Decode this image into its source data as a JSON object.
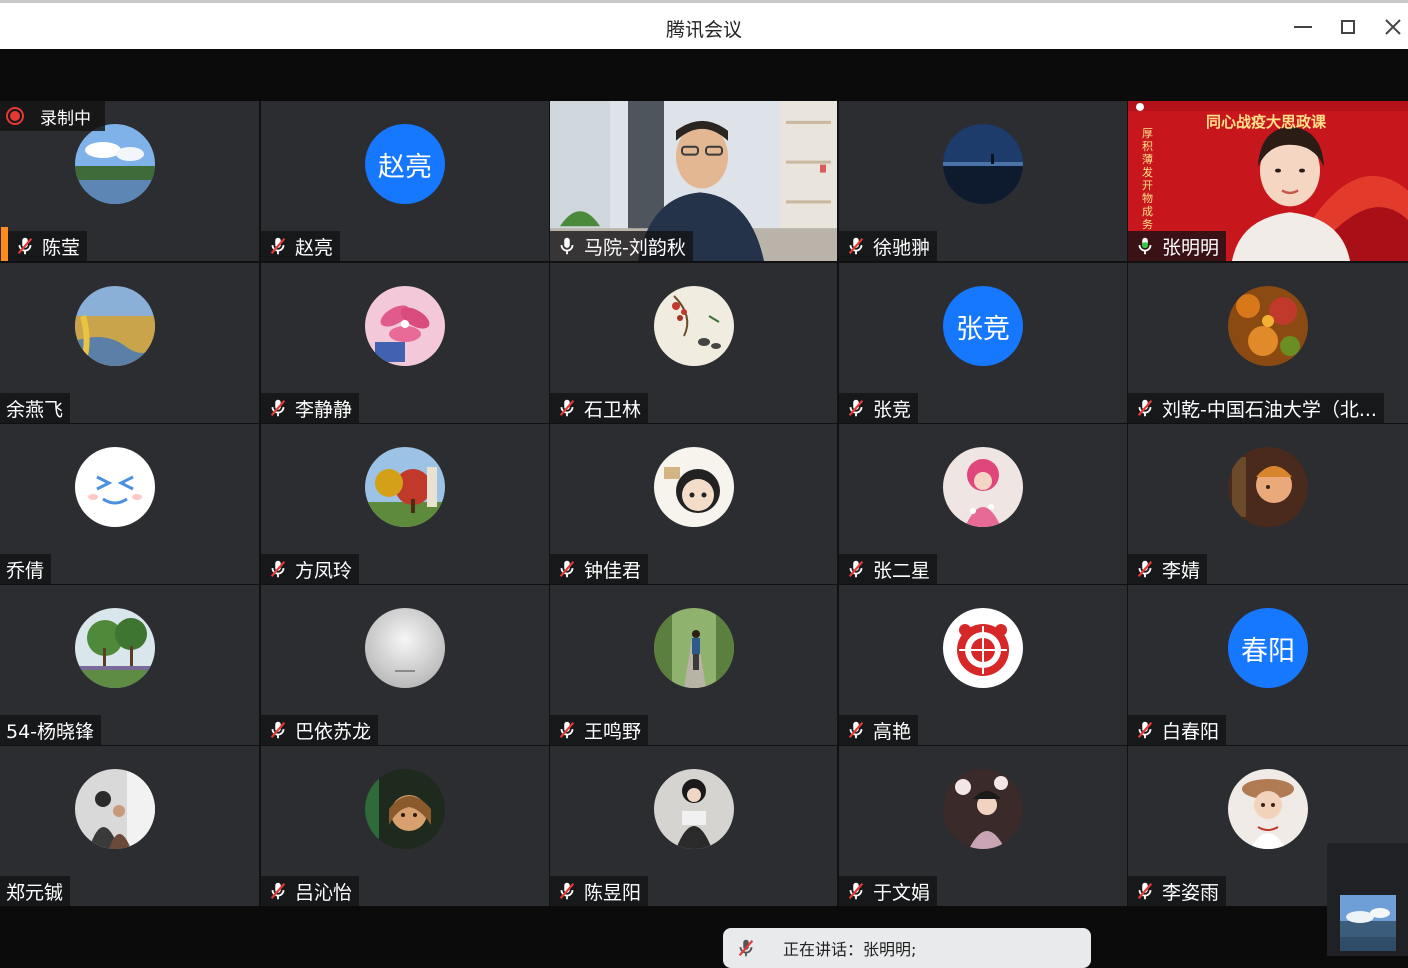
{
  "window": {
    "title": "腾讯会议"
  },
  "recording": {
    "label": "录制中"
  },
  "participants": [
    {
      "name": "陈莹",
      "avatar": "landscape-lake-photo",
      "mic": "muted"
    },
    {
      "name": "赵亮",
      "avatar_text": "赵亮",
      "mic": "muted"
    },
    {
      "name": "马院-刘韵秋",
      "video": "man-in-room-camera",
      "mic": "unmuted"
    },
    {
      "name": "徐驰翀",
      "avatar": "night-sky-photo",
      "mic": "muted"
    },
    {
      "name": "张明明",
      "video": "woman-red-banner-camera",
      "mic": "speaking"
    },
    {
      "name": "余燕飞",
      "avatar": "autumn-wetland-photo",
      "mic": "none"
    },
    {
      "name": "李静静",
      "avatar": "pink-flower-photo",
      "mic": "muted"
    },
    {
      "name": "石卫林",
      "avatar": "ink-painting-birds",
      "mic": "muted"
    },
    {
      "name": "张竞",
      "avatar_text": "张竞",
      "mic": "muted"
    },
    {
      "name": "刘乾-中国石油大学（北...",
      "avatar": "autumn-leaves-photo",
      "mic": "muted"
    },
    {
      "name": "乔倩",
      "avatar": "smiley-face",
      "mic": "none"
    },
    {
      "name": "方凤玲",
      "avatar": "red-tree-photo",
      "mic": "muted"
    },
    {
      "name": "钟佳君",
      "avatar": "cartoon-girl-drawing",
      "mic": "muted"
    },
    {
      "name": "张二星",
      "avatar": "pink-doll-photo",
      "mic": "muted"
    },
    {
      "name": "李婧",
      "avatar": "child-portrait-photo",
      "mic": "muted"
    },
    {
      "name": "54-杨晓锋",
      "avatar": "green-trees-photo",
      "mic": "none"
    },
    {
      "name": "巴依苏龙",
      "avatar": "foggy-sky-photo",
      "mic": "muted"
    },
    {
      "name": "王鸣野",
      "avatar": "person-walking-photo",
      "mic": "muted"
    },
    {
      "name": "高艳",
      "avatar": "red-papercut",
      "mic": "muted"
    },
    {
      "name": "白春阳",
      "avatar_text": "春阳",
      "mic": "muted"
    },
    {
      "name": "郑元铖",
      "avatar": "people-photo",
      "mic": "none"
    },
    {
      "name": "吕沁怡",
      "avatar": "girl-portrait-photo",
      "mic": "muted"
    },
    {
      "name": "陈昱阳",
      "avatar": "girl-sitting-photo",
      "mic": "muted"
    },
    {
      "name": "于文娟",
      "avatar": "costume-woman-photo",
      "mic": "muted"
    },
    {
      "name": "李姿雨",
      "avatar": "girl-hat-photo",
      "mic": "muted"
    }
  ],
  "video_overlays": {
    "banner_title": "同心战疫大思政课",
    "banner_side": "厚积薄发 开物成务"
  },
  "speaking_toast": {
    "label": "正在讲话：张明明;"
  },
  "colors": {
    "tile_bg": "#2b2d31",
    "avatar_blue": "#1677ff",
    "active_speaker": "#ff8a1f",
    "recording_red": "#e53935",
    "speaking_green": "#2ecc40"
  }
}
